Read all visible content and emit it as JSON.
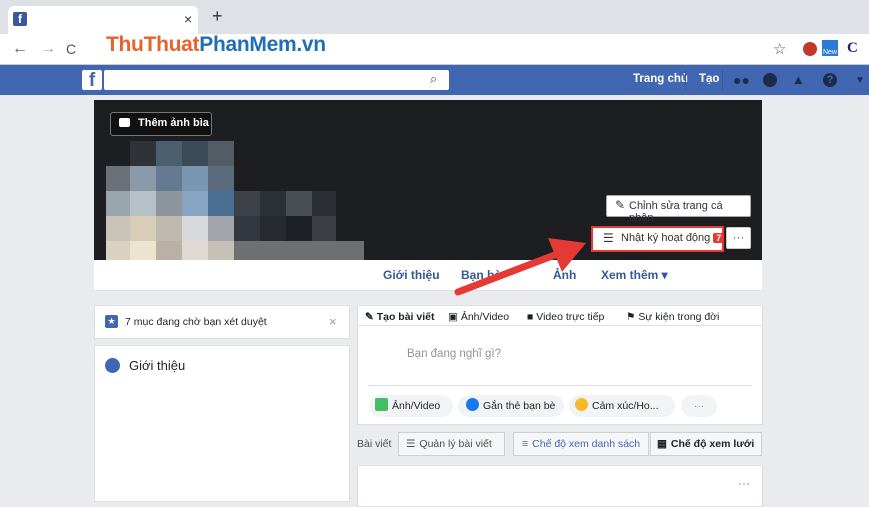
{
  "browser": {
    "tab_title": "",
    "tab_close": "×",
    "new_tab": "+",
    "back": "←",
    "forward": "→",
    "reload": "C",
    "watermark_a": "ThuThuat",
    "watermark_b": "PhanMem.vn",
    "star": "☆",
    "ext_new": "New",
    "ext_c": "C"
  },
  "fb_header": {
    "logo": "f",
    "search_placeholder": "",
    "home": "Trang chủ",
    "create": "Tạo"
  },
  "cover": {
    "add_cover": "Thêm ảnh bìa",
    "edit_profile": "Chỉnh sửa trang cá nhân",
    "activity_log": "Nhật ký hoạt động",
    "activity_badge": "7",
    "more": "···"
  },
  "profile_tabs": [
    "Giới thiệu",
    "Bạn bè",
    "Ảnh",
    "Xem thêm ▾"
  ],
  "left": {
    "pending_text": "7 mục đang chờ bạn xét duyệt",
    "pending_close": "×",
    "intro_title": "Giới thiệu"
  },
  "composer": {
    "tabs": [
      "Tạo bài viết",
      "Ảnh/Video",
      "Video trực tiếp",
      "Sự kiện trong đời"
    ],
    "placeholder": "Bạn đang nghĩ gì?",
    "actions": [
      "Ảnh/Video",
      "Gắn thẻ bạn bè",
      "Cảm xúc/Ho...",
      "···"
    ]
  },
  "posts": {
    "label": "Bài viết",
    "manage": "Quản lý bài viết",
    "list_view": "Chế độ xem danh sách",
    "grid_view": "Chế độ xem lưới",
    "card_more": "···"
  },
  "colors": {
    "fb_blue": "#4267b2",
    "highlight_red": "#e53935",
    "cover_bg": "#1c1e21"
  }
}
